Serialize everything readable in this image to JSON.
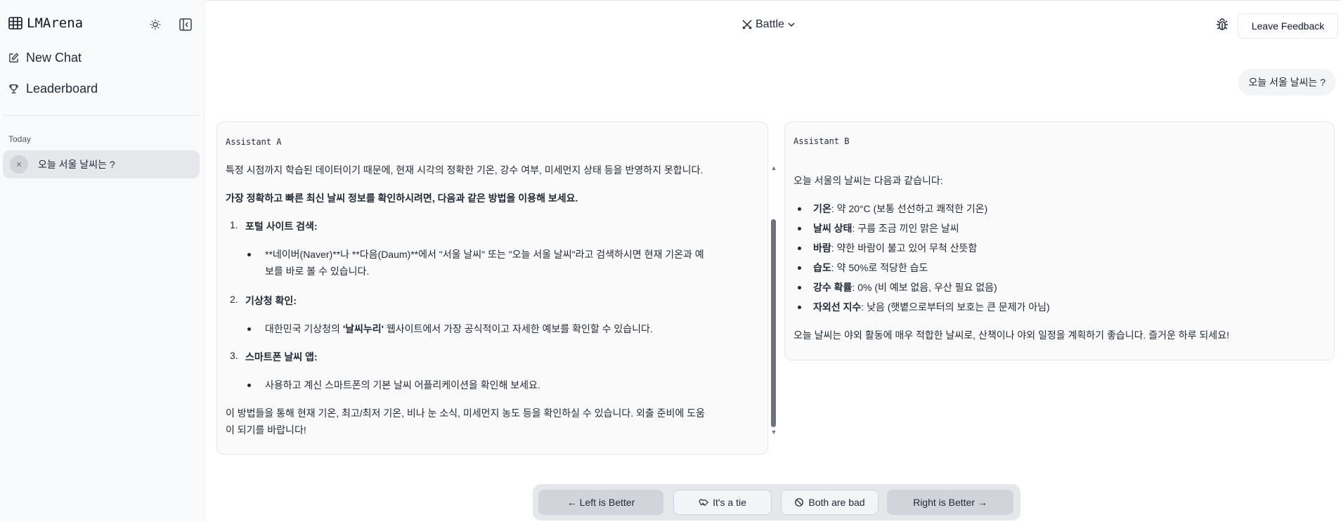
{
  "sidebar": {
    "logo": "LMArena",
    "new_chat": "New Chat",
    "leaderboard": "Leaderboard",
    "section": "Today",
    "chat_item": "오늘 서울 날씨는 ?"
  },
  "header": {
    "mode": "Battle",
    "feedback": "Leave Feedback"
  },
  "user_message": "오늘 서울 날씨는 ?",
  "assistant_a": {
    "label": "Assistant A",
    "intro": "특정 시점까지 학습된 데이터이기 때문에, 현재 시각의 정확한 기온, 강수 여부, 미세먼지 상태 등을 반영하지 못합니다.",
    "bold_line": "가장 정확하고 빠른 최신 날씨 정보를 확인하시려면, 다음과 같은 방법을 이용해 보세요.",
    "items": [
      {
        "num": "1.",
        "title": "포털 사이트 검색:",
        "bullet_line1": "**네이버(Naver)**나 **다음(Daum)**에서 \"서울 날씨\" 또는 \"오늘 서울 날씨\"라고 검색하시면 현재 기온과 예",
        "bullet_line2": "보를 바로 볼 수 있습니다."
      },
      {
        "num": "2.",
        "title": "기상청 확인:",
        "bullet_pre": "대한민국 기상청의 ",
        "bullet_bold": "'날씨누리'",
        "bullet_post": " 웹사이트에서 가장 공식적이고 자세한 예보를 확인할 수 있습니다."
      },
      {
        "num": "3.",
        "title": "스마트폰 날씨 앱:",
        "bullet": "사용하고 계신 스마트폰의 기본 날씨 어플리케이션을 확인해 보세요."
      }
    ],
    "outro_line1": "이 방법들을 통해 현재 기온, 최고/최저 기온, 비나 눈 소식, 미세먼지 농도 등을 확인하실 수 있습니다. 외출 준비에 도움",
    "outro_line2": "이 되기를 바랍니다!"
  },
  "assistant_b": {
    "label": "Assistant B",
    "intro": "오늘 서울의 날씨는 다음과 같습니다:",
    "items": [
      {
        "key": "기온",
        "value": ": 약 20°C (보통 선선하고 쾌적한 기온)"
      },
      {
        "key": "날씨 상태",
        "value": ": 구름 조금 끼인 맑은 날씨"
      },
      {
        "key": "바람",
        "value": ": 약한 바람이 불고 있어 무척 산뜻함"
      },
      {
        "key": "습도",
        "value": ": 약 50%로 적당한 습도"
      },
      {
        "key": "강수 확률",
        "value": ": 0% (비 예보 없음, 우산 필요 없음)"
      },
      {
        "key": "자외선 지수",
        "value": ": 낮음 (햇볕으로부터의 보호는 큰 문제가 아님)"
      }
    ],
    "outro": "오늘 날씨는 야외 활동에 매우 적합한 날씨로, 산책이나 야외 일정을 계획하기 좋습니다. 즐거운 하루 되세요!"
  },
  "vote": {
    "left": "← Left is Better",
    "tie": "It's a tie",
    "bad": "Both are bad",
    "right": "Right is Better →"
  }
}
